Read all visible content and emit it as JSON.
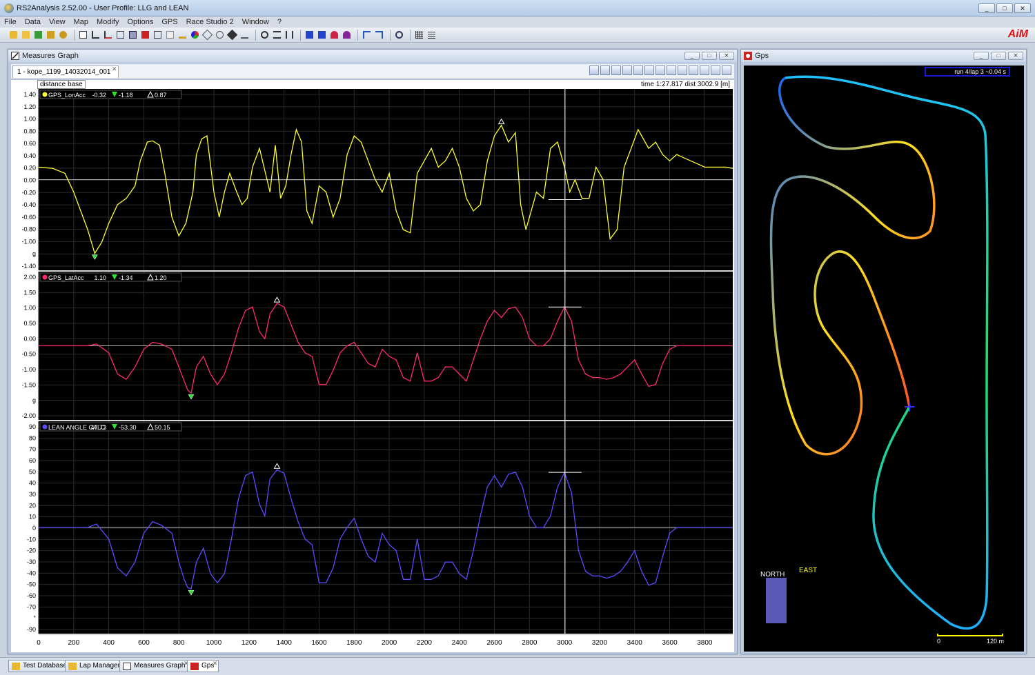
{
  "app": {
    "title": "RS2Analysis 2.52.00 - User Profile: LLG and LEAN",
    "brand": "AiM"
  },
  "menu": [
    "File",
    "Data",
    "View",
    "Map",
    "Modify",
    "Options",
    "GPS",
    "Race Studio 2",
    "Window",
    "?"
  ],
  "window_buttons": {
    "minimize": "_",
    "restore": "□",
    "close": "✕"
  },
  "measures": {
    "title": "Measures Graph",
    "tab": "1 - kope_1199_14032014_001",
    "base": "distance base",
    "time_readout": "time 1:27.817   dist 3002.9 [m]",
    "channels": [
      {
        "name": "GPS_LonAcc",
        "value": "-0.32",
        "min": "-1.18",
        "max": "0.87",
        "color": "#ffff33"
      },
      {
        "name": "GPS_LatAcc",
        "value": "1.10",
        "min": "-1.34",
        "max": "1.20",
        "color": "#ff2a70"
      },
      {
        "name": "LEAN ANGLE CALC",
        "value": "47.73",
        "min": "-53.30",
        "max": "50.15",
        "color": "#5a4cff"
      }
    ],
    "panel_ticks": [
      [
        "1.40",
        "1.20",
        "1.00",
        "0.80",
        "0.60",
        "0.40",
        "0.20",
        "0.00",
        "-0.20",
        "-0.40",
        "-0.60",
        "-0.80",
        "-1.00",
        "g",
        "-1.40"
      ],
      [
        "2.00",
        "1.50",
        "1.00",
        "0.50",
        "0.00",
        "-0.50",
        "-1.00",
        "-1.50",
        "g",
        "-2.00"
      ],
      [
        "90",
        "80",
        "70",
        "60",
        "50",
        "40",
        "30",
        "20",
        "10",
        "0",
        "-10",
        "-20",
        "-30",
        "-40",
        "-50",
        "-60",
        "-70",
        "°",
        "-90"
      ]
    ],
    "x_ticks": [
      "0",
      "200",
      "400",
      "600",
      "800",
      "1000",
      "1200",
      "1400",
      "1600",
      "1800",
      "2000",
      "2200",
      "2400",
      "2600",
      "2800",
      "3000",
      "3200",
      "3400",
      "3600",
      "3800"
    ]
  },
  "chart_data": [
    {
      "type": "line",
      "series": [
        {
          "name": "GPS_LonAcc",
          "x": [
            0,
            80,
            150,
            200,
            280,
            320,
            360,
            400,
            450,
            500,
            550,
            580,
            620,
            650,
            690,
            720,
            760,
            800,
            840,
            880,
            900,
            930,
            960,
            1000,
            1030,
            1060,
            1090,
            1130,
            1160,
            1190,
            1220,
            1260,
            1290,
            1320,
            1350,
            1380,
            1410,
            1440,
            1470,
            1500,
            1530,
            1560,
            1600,
            1640,
            1680,
            1720,
            1760,
            1800,
            1840,
            1880,
            1920,
            1960,
            2000,
            2040,
            2080,
            2120,
            2160,
            2200,
            2240,
            2280,
            2320,
            2360,
            2400,
            2440,
            2480,
            2520,
            2560,
            2600,
            2640,
            2680,
            2720,
            2750,
            2780,
            2810,
            2840,
            2880,
            2920,
            2960,
            3000,
            3030,
            3060,
            3100,
            3140,
            3180,
            3220,
            3260,
            3300,
            3340,
            3380,
            3420,
            3440,
            3480,
            3520,
            3560,
            3600,
            3640,
            3680,
            3720,
            3760,
            3800,
            3840,
            3880,
            3920,
            3960
          ],
          "y": [
            0.2,
            0.18,
            0.1,
            -0.2,
            -0.8,
            -1.18,
            -1.0,
            -0.7,
            -0.4,
            -0.3,
            -0.1,
            0.3,
            0.6,
            0.62,
            0.55,
            0.1,
            -0.6,
            -0.9,
            -0.7,
            -0.2,
            0.4,
            0.65,
            0.7,
            -0.2,
            -0.6,
            -0.2,
            0.1,
            -0.2,
            -0.4,
            -0.3,
            0.2,
            0.5,
            0.15,
            -0.2,
            0.55,
            -0.3,
            -0.1,
            0.4,
            0.8,
            0.6,
            -0.5,
            -0.7,
            -0.1,
            -0.2,
            -0.6,
            -0.3,
            0.4,
            0.7,
            0.6,
            0.3,
            0.0,
            -0.2,
            0.1,
            -0.5,
            -0.8,
            -0.85,
            0.1,
            0.3,
            0.5,
            0.2,
            0.3,
            0.5,
            0.2,
            -0.3,
            -0.5,
            -0.4,
            0.3,
            0.7,
            0.87,
            0.6,
            0.75,
            -0.4,
            -0.8,
            -0.5,
            -0.2,
            -0.3,
            0.5,
            0.6,
            0.2,
            -0.2,
            0.0,
            -0.3,
            -0.3,
            0.2,
            0.0,
            -0.95,
            -0.8,
            0.2,
            0.5,
            0.8,
            0.7,
            0.5,
            0.6,
            0.4,
            0.3,
            0.4,
            0.35,
            0.3,
            0.25,
            0.2,
            0.2,
            0.2,
            0.2,
            0.18
          ]
        }
      ],
      "xlim": [
        0,
        3960
      ],
      "ylim": [
        -1.45,
        1.45
      ],
      "xlabel": "",
      "ylabel": ""
    },
    {
      "type": "line",
      "series": [
        {
          "name": "GPS_LatAcc",
          "x": [
            0,
            200,
            280,
            330,
            400,
            450,
            500,
            550,
            600,
            650,
            700,
            760,
            800,
            830,
            850,
            870,
            900,
            940,
            980,
            1020,
            1060,
            1100,
            1140,
            1180,
            1220,
            1260,
            1290,
            1320,
            1360,
            1400,
            1440,
            1480,
            1520,
            1560,
            1600,
            1640,
            1680,
            1720,
            1760,
            1800,
            1840,
            1880,
            1920,
            1960,
            2000,
            2040,
            2080,
            2120,
            2160,
            2200,
            2240,
            2280,
            2320,
            2360,
            2400,
            2440,
            2480,
            2520,
            2560,
            2600,
            2640,
            2680,
            2720,
            2760,
            2800,
            2840,
            2880,
            2920,
            2960,
            3000,
            3040,
            3080,
            3120,
            3160,
            3200,
            3240,
            3280,
            3320,
            3360,
            3400,
            3440,
            3480,
            3520,
            3560,
            3600,
            3640,
            3700,
            3760,
            3800,
            3880,
            3960
          ],
          "y": [
            0.0,
            0.0,
            0.0,
            0.05,
            -0.2,
            -0.8,
            -0.95,
            -0.6,
            -0.1,
            0.1,
            0.05,
            -0.1,
            -0.6,
            -1.0,
            -1.25,
            -1.34,
            -0.6,
            -0.3,
            -0.8,
            -1.1,
            -0.8,
            -0.2,
            0.5,
            1.0,
            1.1,
            0.4,
            0.2,
            0.9,
            1.2,
            1.1,
            0.6,
            0.1,
            -0.2,
            -0.3,
            -1.1,
            -1.1,
            -0.7,
            -0.2,
            0.0,
            0.1,
            -0.2,
            -0.5,
            -0.6,
            -0.1,
            -0.3,
            -0.4,
            -0.9,
            -1.0,
            -0.2,
            -1.0,
            -1.0,
            -0.9,
            -0.6,
            -0.6,
            -0.8,
            -1.0,
            -0.4,
            0.2,
            0.7,
            1.0,
            0.8,
            1.05,
            1.1,
            0.8,
            0.2,
            0.0,
            0.0,
            0.2,
            0.7,
            1.1,
            0.7,
            -0.4,
            -0.8,
            -0.9,
            -0.9,
            -0.95,
            -0.9,
            -0.8,
            -0.6,
            -0.4,
            -0.8,
            -1.15,
            -1.1,
            -0.5,
            -0.1,
            0.0,
            0.0,
            0.0,
            0.0,
            0.0,
            0.0
          ]
        }
      ],
      "xlim": [
        0,
        3960
      ],
      "ylim": [
        -2.1,
        2.1
      ],
      "xlabel": "",
      "ylabel": ""
    },
    {
      "type": "line",
      "series": [
        {
          "name": "LEAN ANGLE CALC",
          "x": [
            0,
            200,
            280,
            330,
            400,
            450,
            500,
            550,
            600,
            650,
            700,
            760,
            800,
            830,
            850,
            870,
            900,
            940,
            980,
            1020,
            1060,
            1100,
            1140,
            1180,
            1220,
            1260,
            1290,
            1320,
            1360,
            1400,
            1440,
            1480,
            1520,
            1560,
            1600,
            1640,
            1680,
            1720,
            1760,
            1800,
            1840,
            1880,
            1920,
            1960,
            2000,
            2040,
            2080,
            2120,
            2160,
            2200,
            2240,
            2280,
            2320,
            2360,
            2400,
            2440,
            2480,
            2520,
            2560,
            2600,
            2640,
            2680,
            2720,
            2760,
            2800,
            2840,
            2880,
            2920,
            2960,
            3000,
            3040,
            3080,
            3120,
            3160,
            3200,
            3240,
            3280,
            3320,
            3360,
            3400,
            3440,
            3480,
            3520,
            3560,
            3600,
            3640,
            3700,
            3760,
            3800,
            3880,
            3960
          ],
          "y": [
            0,
            0,
            0,
            3,
            -10,
            -35,
            -42,
            -30,
            -5,
            5,
            2,
            -5,
            -30,
            -45,
            -52,
            -53.3,
            -30,
            -18,
            -40,
            -48,
            -40,
            -10,
            25,
            45,
            48,
            20,
            10,
            42,
            50,
            47,
            25,
            5,
            -10,
            -15,
            -48,
            -48,
            -35,
            -10,
            0,
            8,
            -10,
            -25,
            -30,
            -5,
            -15,
            -20,
            -45,
            -45,
            -10,
            -45,
            -45,
            -42,
            -30,
            -30,
            -40,
            -45,
            -20,
            10,
            35,
            45,
            35,
            46,
            48,
            35,
            10,
            0,
            0,
            10,
            35,
            47.7,
            30,
            -20,
            -38,
            -42,
            -42,
            -44,
            -42,
            -38,
            -30,
            -20,
            -38,
            -50,
            -48,
            -25,
            -5,
            0,
            0,
            0,
            0,
            0,
            0
          ]
        }
      ],
      "xlim": [
        0,
        3960
      ],
      "ylim": [
        -92,
        92
      ],
      "xlabel": "",
      "ylabel": ""
    }
  ],
  "gps": {
    "title": "Gps",
    "run_label": "run 4/lap 3 ~0.04 s",
    "compass_north": "NORTH",
    "compass_east": "EAST",
    "scale_min": "0",
    "scale_max": "120 m"
  },
  "taskbar": [
    {
      "label": "Test Database"
    },
    {
      "label": "Lap Manager"
    },
    {
      "label": "Measures Graph"
    },
    {
      "label": "Gps"
    }
  ]
}
